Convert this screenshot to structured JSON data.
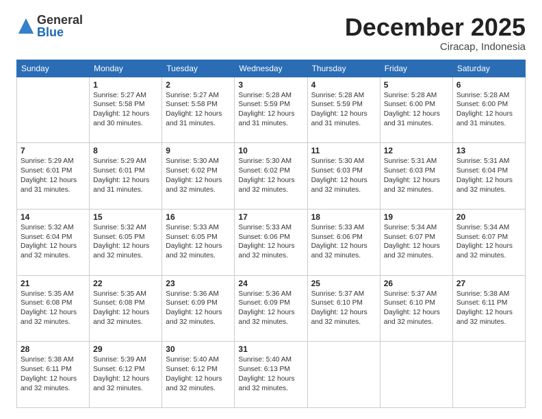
{
  "header": {
    "logo_general": "General",
    "logo_blue": "Blue",
    "month_title": "December 2025",
    "location": "Ciracap, Indonesia"
  },
  "days_of_week": [
    "Sunday",
    "Monday",
    "Tuesday",
    "Wednesday",
    "Thursday",
    "Friday",
    "Saturday"
  ],
  "weeks": [
    [
      {
        "day": "",
        "info": ""
      },
      {
        "day": "1",
        "info": "Sunrise: 5:27 AM\nSunset: 5:58 PM\nDaylight: 12 hours\nand 30 minutes."
      },
      {
        "day": "2",
        "info": "Sunrise: 5:27 AM\nSunset: 5:58 PM\nDaylight: 12 hours\nand 31 minutes."
      },
      {
        "day": "3",
        "info": "Sunrise: 5:28 AM\nSunset: 5:59 PM\nDaylight: 12 hours\nand 31 minutes."
      },
      {
        "day": "4",
        "info": "Sunrise: 5:28 AM\nSunset: 5:59 PM\nDaylight: 12 hours\nand 31 minutes."
      },
      {
        "day": "5",
        "info": "Sunrise: 5:28 AM\nSunset: 6:00 PM\nDaylight: 12 hours\nand 31 minutes."
      },
      {
        "day": "6",
        "info": "Sunrise: 5:28 AM\nSunset: 6:00 PM\nDaylight: 12 hours\nand 31 minutes."
      }
    ],
    [
      {
        "day": "7",
        "info": "Sunrise: 5:29 AM\nSunset: 6:01 PM\nDaylight: 12 hours\nand 31 minutes."
      },
      {
        "day": "8",
        "info": "Sunrise: 5:29 AM\nSunset: 6:01 PM\nDaylight: 12 hours\nand 31 minutes."
      },
      {
        "day": "9",
        "info": "Sunrise: 5:30 AM\nSunset: 6:02 PM\nDaylight: 12 hours\nand 32 minutes."
      },
      {
        "day": "10",
        "info": "Sunrise: 5:30 AM\nSunset: 6:02 PM\nDaylight: 12 hours\nand 32 minutes."
      },
      {
        "day": "11",
        "info": "Sunrise: 5:30 AM\nSunset: 6:03 PM\nDaylight: 12 hours\nand 32 minutes."
      },
      {
        "day": "12",
        "info": "Sunrise: 5:31 AM\nSunset: 6:03 PM\nDaylight: 12 hours\nand 32 minutes."
      },
      {
        "day": "13",
        "info": "Sunrise: 5:31 AM\nSunset: 6:04 PM\nDaylight: 12 hours\nand 32 minutes."
      }
    ],
    [
      {
        "day": "14",
        "info": "Sunrise: 5:32 AM\nSunset: 6:04 PM\nDaylight: 12 hours\nand 32 minutes."
      },
      {
        "day": "15",
        "info": "Sunrise: 5:32 AM\nSunset: 6:05 PM\nDaylight: 12 hours\nand 32 minutes."
      },
      {
        "day": "16",
        "info": "Sunrise: 5:33 AM\nSunset: 6:05 PM\nDaylight: 12 hours\nand 32 minutes."
      },
      {
        "day": "17",
        "info": "Sunrise: 5:33 AM\nSunset: 6:06 PM\nDaylight: 12 hours\nand 32 minutes."
      },
      {
        "day": "18",
        "info": "Sunrise: 5:33 AM\nSunset: 6:06 PM\nDaylight: 12 hours\nand 32 minutes."
      },
      {
        "day": "19",
        "info": "Sunrise: 5:34 AM\nSunset: 6:07 PM\nDaylight: 12 hours\nand 32 minutes."
      },
      {
        "day": "20",
        "info": "Sunrise: 5:34 AM\nSunset: 6:07 PM\nDaylight: 12 hours\nand 32 minutes."
      }
    ],
    [
      {
        "day": "21",
        "info": "Sunrise: 5:35 AM\nSunset: 6:08 PM\nDaylight: 12 hours\nand 32 minutes."
      },
      {
        "day": "22",
        "info": "Sunrise: 5:35 AM\nSunset: 6:08 PM\nDaylight: 12 hours\nand 32 minutes."
      },
      {
        "day": "23",
        "info": "Sunrise: 5:36 AM\nSunset: 6:09 PM\nDaylight: 12 hours\nand 32 minutes."
      },
      {
        "day": "24",
        "info": "Sunrise: 5:36 AM\nSunset: 6:09 PM\nDaylight: 12 hours\nand 32 minutes."
      },
      {
        "day": "25",
        "info": "Sunrise: 5:37 AM\nSunset: 6:10 PM\nDaylight: 12 hours\nand 32 minutes."
      },
      {
        "day": "26",
        "info": "Sunrise: 5:37 AM\nSunset: 6:10 PM\nDaylight: 12 hours\nand 32 minutes."
      },
      {
        "day": "27",
        "info": "Sunrise: 5:38 AM\nSunset: 6:11 PM\nDaylight: 12 hours\nand 32 minutes."
      }
    ],
    [
      {
        "day": "28",
        "info": "Sunrise: 5:38 AM\nSunset: 6:11 PM\nDaylight: 12 hours\nand 32 minutes."
      },
      {
        "day": "29",
        "info": "Sunrise: 5:39 AM\nSunset: 6:12 PM\nDaylight: 12 hours\nand 32 minutes."
      },
      {
        "day": "30",
        "info": "Sunrise: 5:40 AM\nSunset: 6:12 PM\nDaylight: 12 hours\nand 32 minutes."
      },
      {
        "day": "31",
        "info": "Sunrise: 5:40 AM\nSunset: 6:13 PM\nDaylight: 12 hours\nand 32 minutes."
      },
      {
        "day": "",
        "info": ""
      },
      {
        "day": "",
        "info": ""
      },
      {
        "day": "",
        "info": ""
      }
    ]
  ]
}
